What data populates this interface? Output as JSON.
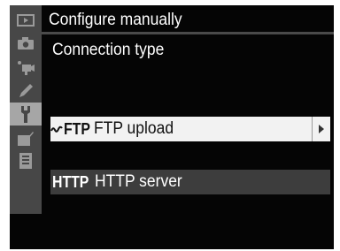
{
  "header": {
    "title": "Configure manually",
    "subtitle": "Connection type"
  },
  "tabs": [
    {
      "icon": "playback-icon"
    },
    {
      "icon": "camera-icon"
    },
    {
      "icon": "movie-icon"
    },
    {
      "icon": "pencil-icon"
    },
    {
      "icon": "wrench-icon",
      "selected": true
    },
    {
      "icon": "retouch-icon"
    },
    {
      "icon": "my-menu-icon"
    }
  ],
  "options": [
    {
      "code": "FTP",
      "label": "FTP upload",
      "icon": "wave-icon",
      "highlighted": true
    },
    {
      "code": "HTTP",
      "label": "HTTP server",
      "highlighted": false
    }
  ],
  "colors": {
    "screen_bg": "#050505",
    "tab_bar": "#474747",
    "tab_selected": "#a6a6a6",
    "row_highlight": "#f2f2f2",
    "row_normal": "#3d3d3d"
  }
}
